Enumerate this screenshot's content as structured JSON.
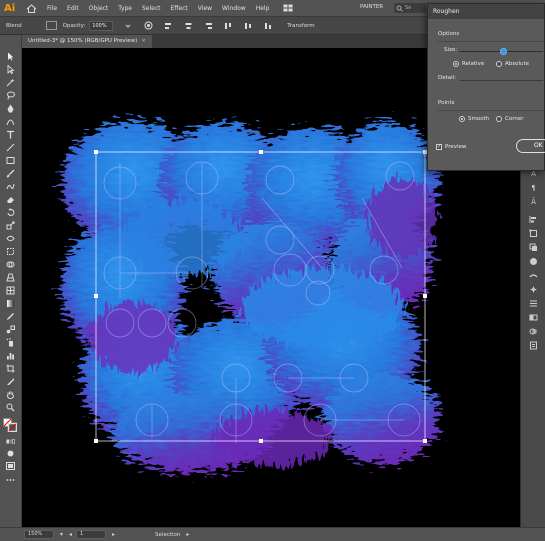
{
  "app": {
    "logo": "Ai"
  },
  "menubar": {
    "items": [
      "File",
      "Edit",
      "Object",
      "Type",
      "Select",
      "Effect",
      "View",
      "Window",
      "Help"
    ],
    "preset": "PAINTER",
    "search_placeholder": "Se"
  },
  "controlbar": {
    "label": "Blend",
    "opacity_label": "Opacity:",
    "opacity_value": "100%",
    "transform_label": "Transform"
  },
  "document": {
    "tab_title": "Untitled-3* @ 150% (RGB/GPU Preview)",
    "close": "×"
  },
  "statusbar": {
    "zoom": "150%",
    "artboard": "1",
    "status": "Selection"
  },
  "dialog": {
    "title": "Roughen",
    "options_label": "Options",
    "size_label": "Size:",
    "size_mode_relative": "Relative",
    "size_mode_absolute": "Absolute",
    "size_mode_selected": "Relative",
    "detail_label": "Detail:",
    "points_label": "Points",
    "points_smooth": "Smooth",
    "points_corner": "Corner",
    "points_selected": "Smooth",
    "preview_label": "Preview",
    "preview_checked": true,
    "ok_label": "OK"
  },
  "panel_strip": {
    "icons": [
      "A",
      "¶",
      "Ā"
    ]
  },
  "colors": {
    "fill_blue": "#2a86e0",
    "fill_purple": "#6a2bb8",
    "selection": "#ffffff",
    "canvas": "#000000",
    "accent": "#ff9a00"
  }
}
